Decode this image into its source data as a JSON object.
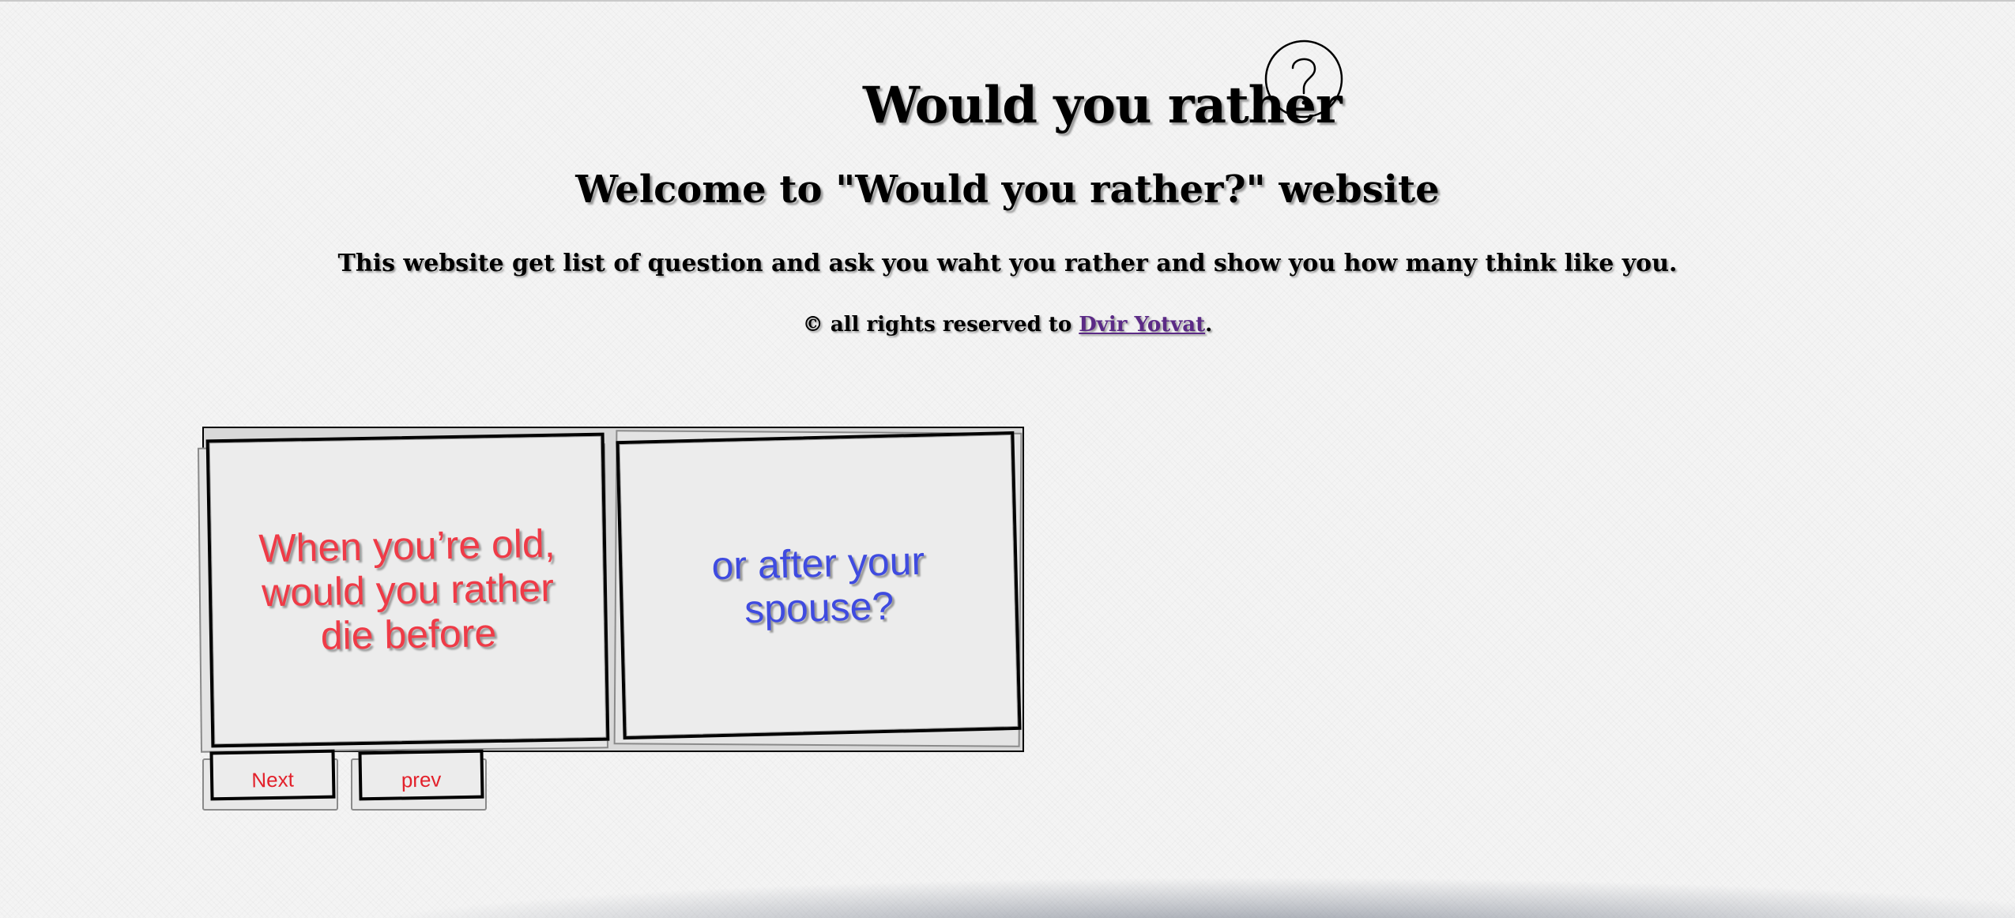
{
  "header": {
    "title": "Would you rather",
    "help_icon": "question-mark-circle-icon",
    "subtitle": "Welcome to \"Would you rather?\" website",
    "description": "This website get list of question and ask you waht you rather and show you how many think like you.",
    "copyright_prefix": "© all rights reserved to ",
    "author_link": "Dvir Yotvat",
    "copyright_suffix": "."
  },
  "question": {
    "option_a": "When you’re old, would you rather die before",
    "option_b": "or after your spouse?"
  },
  "controls": {
    "next_label": "Next",
    "prev_label": "prev"
  },
  "colors": {
    "option_a_text": "#ef3b47",
    "option_b_text": "#3f4be0",
    "button_text": "#e3212b",
    "link": "#5b2a86"
  }
}
